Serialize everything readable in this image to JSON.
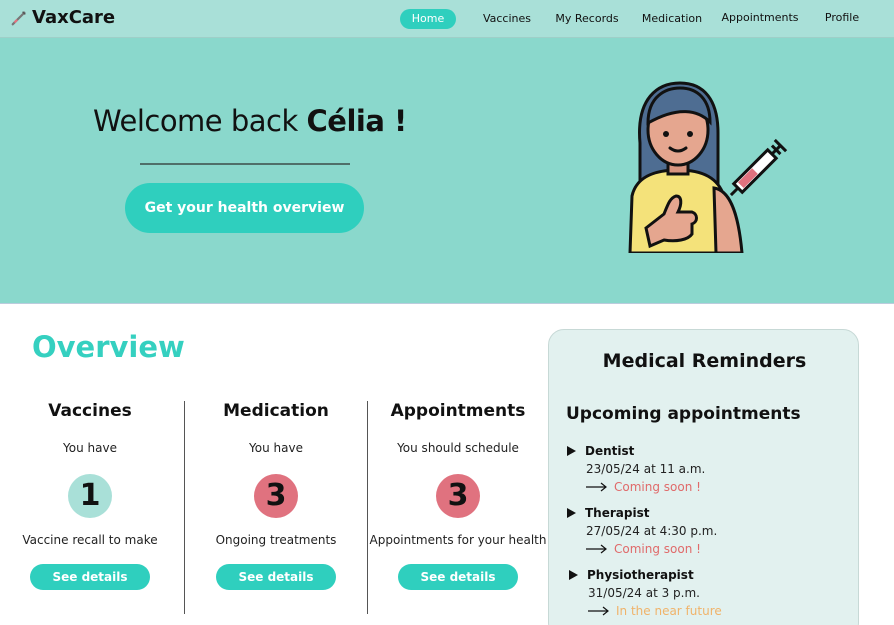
{
  "brand": {
    "name": "VaxCare",
    "icon": "syringe-icon"
  },
  "nav": {
    "items": [
      {
        "label": "Home",
        "active": true
      },
      {
        "label": "Vaccines",
        "active": false
      },
      {
        "label": "My Records",
        "active": false
      },
      {
        "label": "Medication",
        "active": false
      },
      {
        "label": "Appointments",
        "active": false
      },
      {
        "label": "Profile",
        "active": false
      }
    ]
  },
  "hero": {
    "welcome_prefix": "Welcome back ",
    "user_name": "Célia !",
    "cta_label": "Get your health overview",
    "illustration": "vaccinated-person-illustration"
  },
  "overview": {
    "title": "Overview",
    "columns": [
      {
        "title": "Vaccines",
        "subtitle": "You have",
        "count": "1",
        "description": "Vaccine recall to make",
        "button": "See details",
        "color": "#a9e0d8"
      },
      {
        "title": "Medication",
        "subtitle": "You have",
        "count": "3",
        "description": "Ongoing treatments",
        "button": "See details",
        "color": "#e0727f"
      },
      {
        "title": "Appointments",
        "subtitle": "You should schedule",
        "count": "3",
        "description": "Appointments for your health",
        "button": "See details",
        "color": "#e0727f"
      }
    ]
  },
  "reminders": {
    "title": "Medical Reminders",
    "subtitle": "Upcoming appointments",
    "appointments": [
      {
        "name": "Dentist",
        "date": "23/05/24 at 11 a.m.",
        "status": "Coming soon !",
        "status_color": "#e06a6a"
      },
      {
        "name": "Therapist",
        "date": "27/05/24 at 4:30 p.m.",
        "status": "Coming soon !",
        "status_color": "#e06a6a"
      },
      {
        "name": "Physiotherapist",
        "date": "31/05/24 at 3 p.m.",
        "status": "In the near future",
        "status_color": "#f0b36a"
      }
    ]
  },
  "colors": {
    "accent": "#2fcfbe",
    "hero_bg": "#8ad8cc",
    "nav_bg": "#a9e0d8"
  }
}
